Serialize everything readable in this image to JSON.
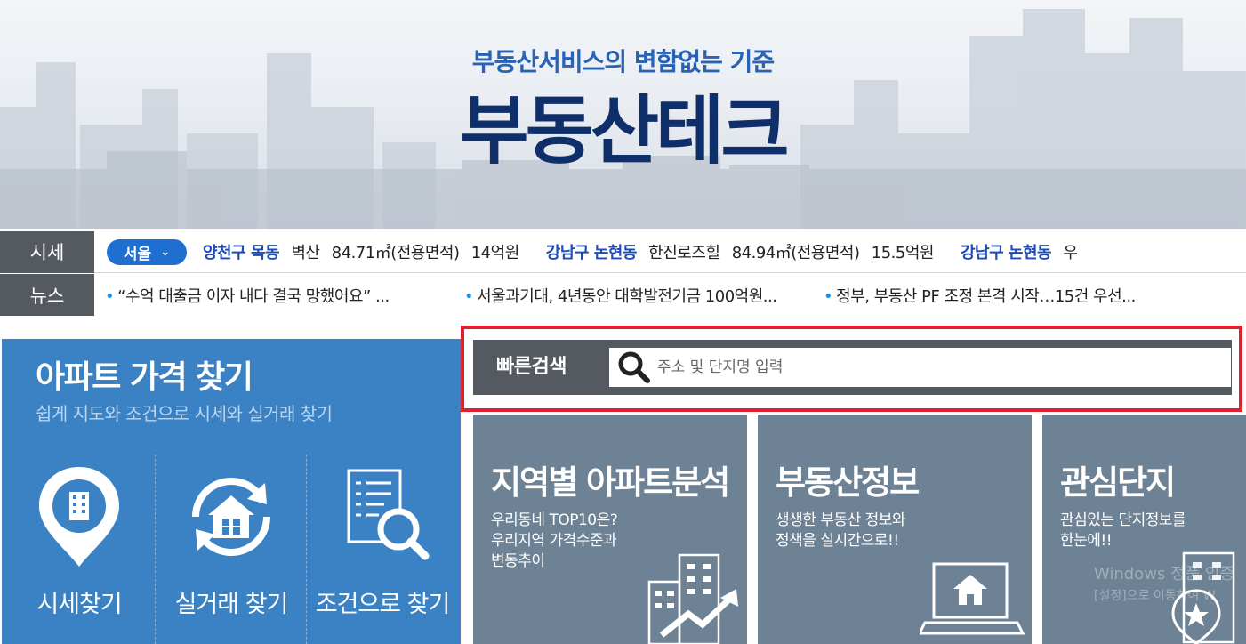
{
  "hero": {
    "subtitle": "부동산서비스의 변함없는 기준",
    "title": "부동산테크"
  },
  "ticker": {
    "quote_label": "시세",
    "region": "서울",
    "quotes": [
      {
        "area": "양천구 목동",
        "name": "벽산",
        "size": "84.71㎡(전용면적)",
        "price": "14억원"
      },
      {
        "area": "강남구 논현동",
        "name": "한진로즈힐",
        "size": "84.94㎡(전용면적)",
        "price": "15.5억원"
      },
      {
        "area": "강남구 논현동",
        "name": "우",
        "size": "",
        "price": ""
      }
    ],
    "news_label": "뉴스",
    "news": [
      "“수억 대출금 이자 내다 결국 망했어요” ...",
      "서울과기대, 4년동안 대학발전기금 100억원...",
      "정부, 부동산 PF 조정 본격 시작…15건 우선..."
    ]
  },
  "apt_panel": {
    "title": "아파트 가격 찾기",
    "subtitle": "쉽게 지도와 조건으로 시세와 실거래 찾기",
    "tools": [
      {
        "label": "시세찾기",
        "icon": "map-pin-building-icon"
      },
      {
        "label": "실거래 찾기",
        "icon": "house-refresh-icon"
      },
      {
        "label": "조건으로 찾기",
        "icon": "document-search-icon"
      }
    ]
  },
  "quick_search": {
    "label": "빠른검색",
    "placeholder": "주소 및 단지명 입력"
  },
  "cards": [
    {
      "title": "지역별 아파트분석",
      "desc": [
        "우리동네 TOP10은?",
        "우리지역 가격수준과",
        "변동추이"
      ],
      "icon": "building-chart-icon"
    },
    {
      "title": "부동산정보",
      "desc": [
        "생생한 부동산 정보와",
        "정책을 실시간으로!!"
      ],
      "icon": "laptop-house-icon"
    },
    {
      "title": "관심단지",
      "desc": [
        "관심있는 단지정보를",
        "한눈에!!"
      ],
      "icon": "building-star-icon"
    }
  ],
  "watermark": {
    "line1": "Windows 정품 인증",
    "line2": "[설정]으로 이동하여 W"
  },
  "colors": {
    "brand_navy": "#0f2f6b",
    "brand_blue": "#2a63b3",
    "panel_blue": "#3b82c4",
    "card_gray": "#6d8295",
    "label_gray": "#555a60",
    "highlight_red": "#e0202f",
    "region_blue": "#1f6fd1"
  }
}
